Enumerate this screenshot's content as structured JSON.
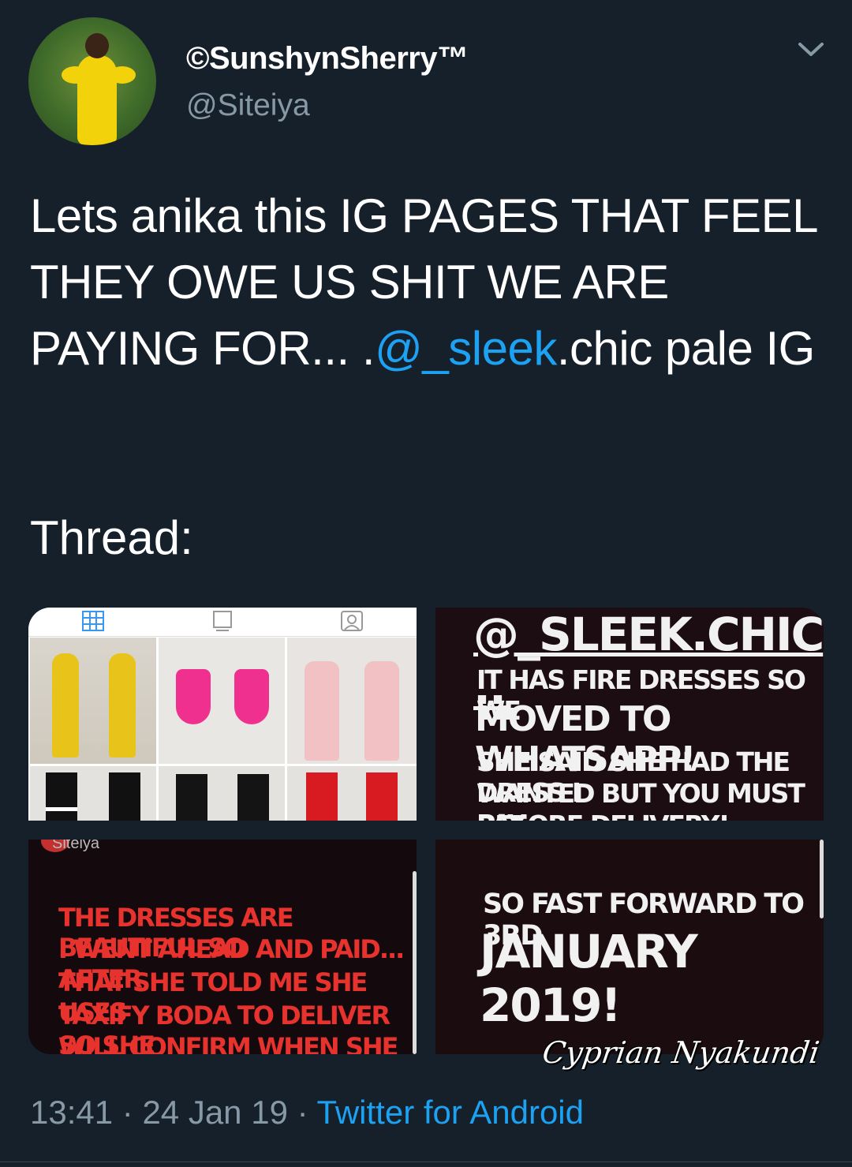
{
  "author": {
    "display_name": "©SunshynSherry™",
    "handle": "@Siteiya"
  },
  "tweet": {
    "text_before": "Lets anika this IG PAGES THAT FEEL THEY OWE US SHIT WE ARE PAYING FOR... .",
    "mention": "@_sleek",
    "text_after": ".chic pale IG",
    "thread_label": "Thread:"
  },
  "media": {
    "story1": {
      "line1": "@_SLEEK.CHIC ..",
      "line2": "IT HAS FIRE DRESSES SO WE",
      "line3": "MOVED TO WHATSAPP!",
      "line4": "SHE SAID SHE HAD THE DRESS I",
      "line5": "WANTED  BUT YOU MUST PAY",
      "line6": "BEFORE DELIVERY!"
    },
    "story2": {
      "header": "Siteiya",
      "lines": [
        "THE DRESSES ARE BEAUTIFUL SO",
        "I WENT AHEAD AND PAID... AFTER",
        "THAT SHE TOLD ME SHE USES",
        "TAXIFY BODA TO DELIVER SO SHE",
        "WILL CONFIRM WHEN SHE CAN"
      ]
    },
    "story3": {
      "line1": "SO FAST FORWARD TO 3RD",
      "line2": "JANUARY 2019!"
    }
  },
  "watermark": "Cyprian Nyakundi",
  "footer": {
    "time": "13:41",
    "date": "24 Jan 19",
    "separator": " · ",
    "source": "Twitter for Android"
  },
  "colors": {
    "background": "#15202b",
    "accent": "#1da1f2",
    "secondary_text": "#8899a6",
    "story_red": "#e8322d"
  },
  "icons": [
    "chevron-down-icon",
    "grid-icon",
    "tv-icon",
    "tagged-icon"
  ]
}
